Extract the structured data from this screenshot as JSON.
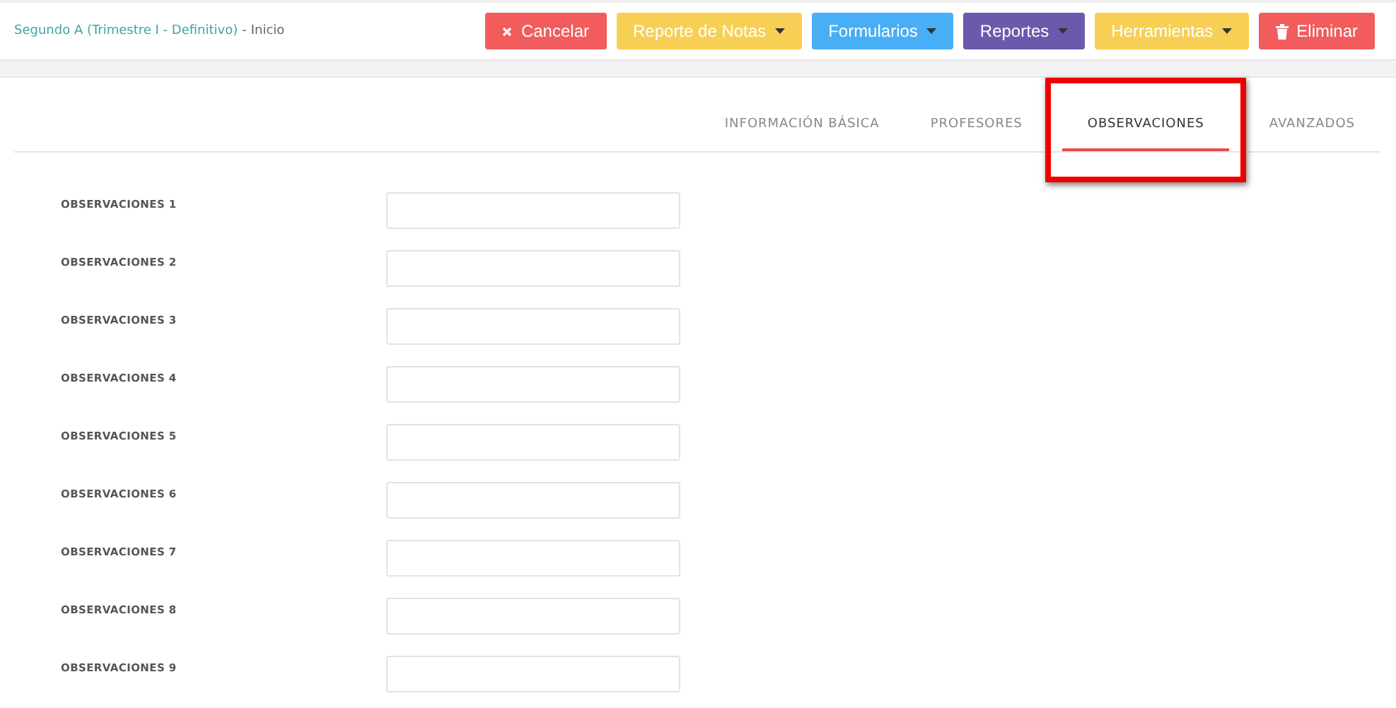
{
  "breadcrumb": [
    {
      "text": "Segundo A (Trimestre I - Definitivo)",
      "kind": "link"
    },
    {
      "text": "-",
      "kind": "separator"
    },
    {
      "text": "Inicio",
      "kind": "current"
    }
  ],
  "buttons": [
    {
      "label": "Cancelar",
      "kind": "cancel",
      "color": "#f25c5c"
    },
    {
      "label": "Reporte de Notas",
      "kind": "dropdown",
      "color": "#f8cf55"
    },
    {
      "label": "Formularios",
      "kind": "dropdown",
      "color": "#48aef5"
    },
    {
      "label": "Reportes",
      "kind": "dropdown",
      "color": "#6d59ac"
    },
    {
      "label": "Herramientas",
      "kind": "dropdown",
      "color": "#f8cf55"
    },
    {
      "label": "Eliminar",
      "kind": "delete",
      "color": "#f25c5c"
    }
  ],
  "tabs": [
    {
      "label": "INFORMACIÓN BÁSICA",
      "selected": false,
      "highlighted": false
    },
    {
      "label": "PROFESORES",
      "selected": false,
      "highlighted": false
    },
    {
      "label": "OBSERVACIONES",
      "selected": true,
      "highlighted": true
    },
    {
      "label": "AVANZADOS",
      "selected": false,
      "highlighted": false
    }
  ],
  "fields": [
    {
      "label": "OBSERVACIONES 1"
    },
    {
      "label": "OBSERVACIONES 2"
    },
    {
      "label": "OBSERVACIONES 3"
    },
    {
      "label": "OBSERVACIONES 4"
    },
    {
      "label": "OBSERVACIONES 5"
    },
    {
      "label": "OBSERVACIONES 6"
    },
    {
      "label": "OBSERVACIONES 7"
    },
    {
      "label": "OBSERVACIONES 8"
    },
    {
      "label": "OBSERVACIONES 9"
    }
  ]
}
